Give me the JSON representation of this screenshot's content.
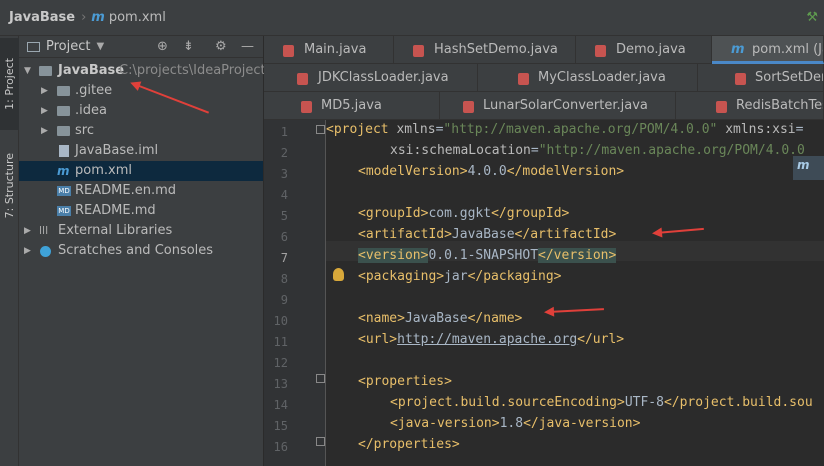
{
  "breadcrumb": {
    "project": "JavaBase",
    "file": "pom.xml",
    "file_icon": "m"
  },
  "project_panel": {
    "title": "Project",
    "root": {
      "name": "JavaBase",
      "path": "C:\\projects\\IdeaProjects\\"
    },
    "items": [
      {
        "name": ".gitee",
        "kind": "folder"
      },
      {
        "name": ".idea",
        "kind": "folder"
      },
      {
        "name": "src",
        "kind": "folder"
      },
      {
        "name": "JavaBase.iml",
        "kind": "file"
      },
      {
        "name": "pom.xml",
        "kind": "maven"
      },
      {
        "name": "README.en.md",
        "kind": "md"
      },
      {
        "name": "README.md",
        "kind": "md"
      }
    ],
    "external_libraries": "External Libraries",
    "scratches": "Scratches and Consoles"
  },
  "side_tabs": {
    "project": "1: Project",
    "structure": "7: Structure"
  },
  "tabs_row1": [
    "Main.java",
    "HashSetDemo.java",
    "Demo.java",
    "pom.xml (Ja"
  ],
  "tabs_row2": [
    "JDKClassLoader.java",
    "MyClassLoader.java",
    "SortSetDem"
  ],
  "tabs_row3": [
    "MD5.java",
    "LunarSolarConverter.java",
    "RedisBatchTest"
  ],
  "line_numbers": [
    "1",
    "2",
    "3",
    "4",
    "5",
    "6",
    "7",
    "8",
    "9",
    "10",
    "11",
    "12",
    "13",
    "14",
    "15",
    "16"
  ],
  "code": {
    "project_tag": "project",
    "xmlns_attr": "xmlns",
    "xmlns_val": "\"http://maven.apache.org/POM/4.0.0\"",
    "xsi_attr": "xmlns:xsi",
    "schema_attr": "xsi:schemaLocation",
    "schema_val": "\"http://maven.apache.org/POM/4.0.0",
    "model_version": "4.0.0",
    "group_id": "com.ggkt",
    "artifact_id": "JavaBase",
    "version": "0.0.1-SNAPSHOT",
    "packaging": "jar",
    "name": "JavaBase",
    "url": "http://maven.apache.org",
    "encoding": "UTF-8",
    "java_version": "1.8"
  },
  "maven_badge": "m",
  "colors": {
    "tag": "#e8bf6a",
    "attr_value": "#6a8759",
    "text": "#a9b7c6",
    "annotation_arrow": "#e0403a"
  }
}
